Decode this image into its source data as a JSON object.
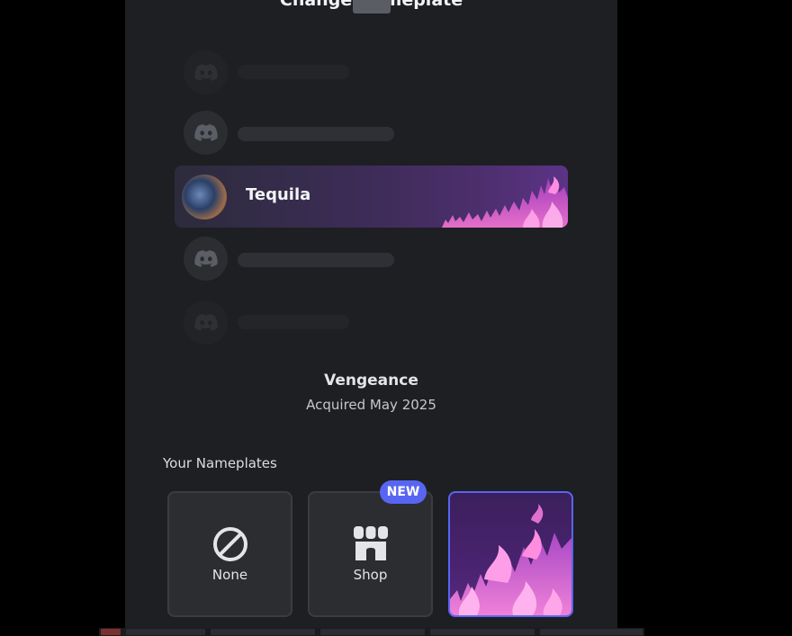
{
  "dialog": {
    "title": "Change Nameplate"
  },
  "preview": {
    "username": "Tequila",
    "accent_color": "#5865f2"
  },
  "selected_nameplate": {
    "name": "Vengeance",
    "acquired": "Acquired May 2025"
  },
  "your_nameplates": {
    "label": "Your Nameplates",
    "items": [
      {
        "label": "None",
        "icon": "no-symbol-icon"
      },
      {
        "label": "Shop",
        "icon": "shop-icon",
        "badge": "NEW"
      },
      {
        "label": "",
        "icon": "vengeance-flames",
        "selected": true
      }
    ]
  }
}
